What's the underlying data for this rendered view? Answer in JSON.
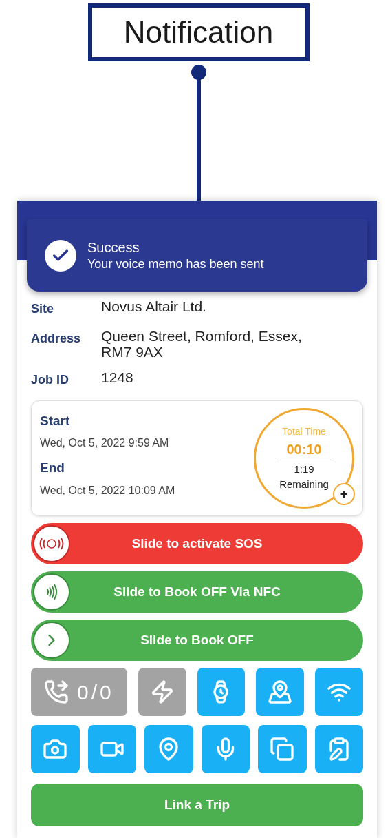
{
  "callout": {
    "label": "Notification"
  },
  "toast": {
    "title": "Success",
    "message": "Your voice memo has been sent"
  },
  "details": [
    {
      "label": "Site",
      "value": "Novus Altair Ltd."
    },
    {
      "label": "Address",
      "value": "Queen Street, Romford, Essex, RM7 9AX"
    },
    {
      "label": "Job ID",
      "value": "1248"
    }
  ],
  "times": [
    {
      "label": "Start",
      "value": "Wed, Oct 5, 2022 9:59 AM"
    },
    {
      "label": "End",
      "value": "Wed, Oct 5, 2022 10:09 AM"
    }
  ],
  "timer": {
    "title": "Total Time",
    "elapsed": "00:10",
    "remaining": "1:19",
    "remaining_label": "Remaining",
    "add": "+"
  },
  "sliders": [
    {
      "kind": "sos",
      "label": "Slide to activate SOS",
      "level": 0
    },
    {
      "kind": "nfc",
      "label": "Slide to Book OFF Via NFC",
      "level": 0
    },
    {
      "kind": "book_off",
      "label": "Slide to Book OFF",
      "level": 0
    }
  ],
  "tools_row_1": [
    {
      "kind": "calls",
      "count": "0/0",
      "disabled": true
    },
    {
      "kind": "flash",
      "disabled": true
    },
    {
      "kind": "watch",
      "disabled": false
    },
    {
      "kind": "map",
      "disabled": false
    },
    {
      "kind": "wifi",
      "disabled": false
    }
  ],
  "tools_row_2": [
    {
      "kind": "camera",
      "disabled": false
    },
    {
      "kind": "video",
      "disabled": false
    },
    {
      "kind": "pin",
      "disabled": false
    },
    {
      "kind": "mic",
      "disabled": false
    },
    {
      "kind": "documents",
      "disabled": false
    },
    {
      "kind": "report",
      "disabled": false
    }
  ],
  "link_button": "Link a Trip"
}
